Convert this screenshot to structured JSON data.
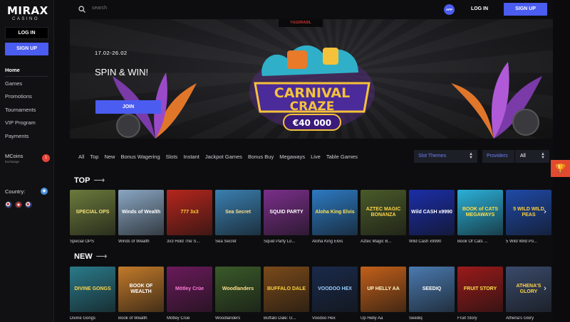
{
  "brand": {
    "logo_main": "MIRAX",
    "logo_sub": "CASINO"
  },
  "topbar": {
    "search_placeholder": "search",
    "app_label": "APP",
    "login": "LOG IN",
    "signup": "SIGN UP"
  },
  "sidebar": {
    "login": "LOG IN",
    "signup": "SIGN UP",
    "items": [
      {
        "label": "Home",
        "active": true
      },
      {
        "label": "Games"
      },
      {
        "label": "Promotions"
      },
      {
        "label": "Tournaments"
      },
      {
        "label": "VIP Program"
      },
      {
        "label": "Payments"
      }
    ],
    "mcoins": {
      "title": "MCoins",
      "subtitle": "Exchange",
      "badge": "1"
    },
    "country_label": "Country:"
  },
  "banner": {
    "provider": "YGGDRASIL",
    "date": "17.02-26.02",
    "headline": "SPIN & WIN!",
    "join": "JOIN",
    "game_title_line1": "CARNIVAL",
    "game_title_line2": "CRAZE",
    "prize": "€40 000"
  },
  "filters": {
    "tabs": [
      "All",
      "Top",
      "New",
      "Bonus Wagering",
      "Slots",
      "Instant",
      "Jackpot Games",
      "Bonus Buy",
      "Megaways",
      "Live",
      "Table Games"
    ],
    "slot_themes": "Slot Themes",
    "providers": "Providers",
    "providers_value": "All"
  },
  "sections": {
    "top": {
      "title": "TOP",
      "games": [
        {
          "name": "Special OPS",
          "art": "SPECIAL OPS",
          "bg": "#6b7a3c",
          "fg": "#f5e27a"
        },
        {
          "name": "Winds of Wealth",
          "art": "Winds of Wealth",
          "bg": "#8aa6c2",
          "fg": "#ffffff"
        },
        {
          "name": "3x3 Hold The S...",
          "art": "777 3x3",
          "bg": "#b5261d",
          "fg": "#ffd23a"
        },
        {
          "name": "Sea Secret",
          "art": "Sea Secret",
          "bg": "#3a7fb0",
          "fg": "#ffe08a"
        },
        {
          "name": "Squid Party Lo...",
          "art": "SQUID PARTY",
          "bg": "#7a2f8a",
          "fg": "#ffffff"
        },
        {
          "name": "Aloha King Elvis",
          "art": "Aloha King Elvis",
          "bg": "#2d7ac2",
          "fg": "#ffe44d"
        },
        {
          "name": "Aztec Magic B...",
          "art": "AZTEC MAGIC BONANZA",
          "bg": "#4a5a2a",
          "fg": "#ffd54a"
        },
        {
          "name": "Wild Cash x9990",
          "art": "Wild CASH x9990",
          "bg": "#1b2ea8",
          "fg": "#ffffff"
        },
        {
          "name": "Book Of Cats ...",
          "art": "BOOK of CATS MEGAWAYS",
          "bg": "#2bb0d8",
          "fg": "#ffe04a"
        },
        {
          "name": "5 Wild Wild Po...",
          "art": "5 WILD WILD PEAS",
          "bg": "#1f4aa8",
          "fg": "#ffd23a"
        }
      ]
    },
    "new": {
      "title": "NEW",
      "games": [
        {
          "name": "Divine Gongs",
          "art": "DIVINE GONGS",
          "bg": "#2a7a8a",
          "fg": "#ffd54a"
        },
        {
          "name": "Book of Wealth",
          "art": "BOOK OF WEALTH",
          "bg": "#c27a2a",
          "fg": "#ffffff"
        },
        {
          "name": "Mötley Crüe",
          "art": "Mötley Crüe",
          "bg": "#6a1a5a",
          "fg": "#ff7ad8"
        },
        {
          "name": "Woodlanders",
          "art": "Woodlanders",
          "bg": "#3a5a2a",
          "fg": "#ffe08a"
        },
        {
          "name": "Buffalo Dale: G...",
          "art": "BUFFALO DALE",
          "bg": "#7a4a1a",
          "fg": "#ffd23a"
        },
        {
          "name": "Voodoo Hex",
          "art": "VOODOO HEX",
          "bg": "#1a2a4a",
          "fg": "#9ad0ff"
        },
        {
          "name": "Up Helly Aa",
          "art": "UP HELLY AA",
          "bg": "#c2601a",
          "fg": "#fff3c2"
        },
        {
          "name": "Seediq",
          "art": "SEEDIQ",
          "bg": "#4a7ab0",
          "fg": "#ffffff"
        },
        {
          "name": "Fruit Story",
          "art": "FRUIT STORY",
          "bg": "#9a1a1a",
          "fg": "#ffe04a"
        },
        {
          "name": "Athena's Glory",
          "art": "ATHENA'S GLORY",
          "bg": "#3a4a6a",
          "fg": "#ffd54a"
        }
      ]
    }
  },
  "colors": {
    "accent": "#4b5cf0",
    "badge": "#e6443a",
    "trophy": "#e24a2f"
  },
  "icons": {
    "search": "search-icon",
    "trophy": "trophy-icon",
    "next": "chevron-right-icon"
  }
}
